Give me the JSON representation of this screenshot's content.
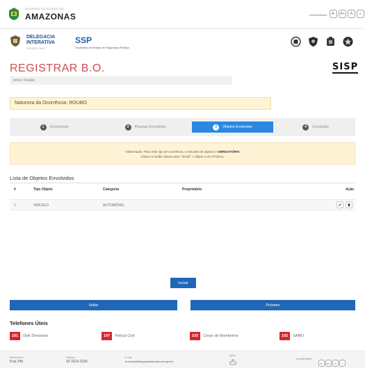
{
  "header": {
    "gov_small": "GOVERNO DO ESTADO DO",
    "gov_name": "AMAZONAS",
    "access_label": "Acessibilidade",
    "access_buttons": [
      "A-",
      "A+",
      "A",
      "◐"
    ]
  },
  "brand": {
    "di_line1": "DELEGACIA",
    "di_line2": "INTERATIVA",
    "di_line3": "POLÍCIA CIVIL",
    "ssp_name": "SSP",
    "ssp_sub": "Secretaria de Estado de Segurança Pública"
  },
  "page": {
    "title": "REGISTRAR B.O.",
    "sisp": "SISP",
    "breadcrumb": "Início / Roubo"
  },
  "nature": {
    "text": "Natureza da Ocorrência: ROUBO"
  },
  "steps": [
    {
      "num": "1",
      "label": "Ocorrências"
    },
    {
      "num": "2",
      "label": "Pessoas Envolvidas"
    },
    {
      "num": "3",
      "label": "Objetos Envolvidos"
    },
    {
      "num": "4",
      "label": "Conclusão"
    }
  ],
  "notice": {
    "line1_before": "Observação: Para este tipo de ocorrência, a inclusão de objetos é ",
    "line1_strong": "OBRIGATÓRIA",
    "line2": "Clique no botão abaixo para \"Incluir\" o objeto e em Próximo."
  },
  "list": {
    "title": "Lista de Objetos Envolvidos",
    "headers": {
      "num": "#",
      "tipo": "Tipo Objeto",
      "categoria": "Categoria",
      "proprietario": "Proprietário",
      "acao": "Ação"
    },
    "rows": [
      {
        "num": "1",
        "tipo": "VEÍCULO",
        "categoria": "AUTOMÓVEL",
        "proprietario": ""
      }
    ],
    "edit_icon": "pencil-icon",
    "delete_icon": "trash-icon"
  },
  "buttons": {
    "incluir": "Incluir",
    "voltar": "Voltar",
    "proximo": "Próximo"
  },
  "phones": {
    "title": "Telefones Úteis",
    "items": [
      {
        "num": "181",
        "label": "Disk Denúncia"
      },
      {
        "num": "197",
        "label": "Polícia Civil"
      },
      {
        "num": "193",
        "label": "Corpo de Bombeiros"
      },
      {
        "num": "192",
        "label": "SAMU"
      }
    ]
  },
  "footer": {
    "hours_cap": "Atendimento",
    "hours_val": "8 às 24h",
    "phone_cap": "Telefone",
    "phone_val": "92 3214-2235",
    "email_cap": "E-mail",
    "email_val": "duvidas@delegaciainterativa.am.gov.br",
    "app_cap": "Apoio",
    "access_label": "Acessibilidade",
    "access_buttons": [
      "A-",
      "A+",
      "A",
      "◐"
    ]
  },
  "colors": {
    "accent_blue": "#2067b8",
    "active_step": "#2a88e0",
    "title_red": "#d04c52",
    "phone_red": "#d9252d"
  }
}
